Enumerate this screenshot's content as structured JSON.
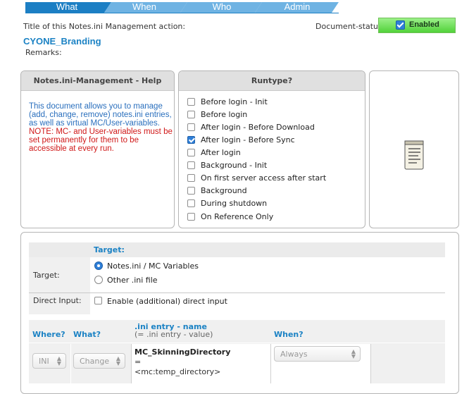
{
  "tabs": [
    {
      "label": "What",
      "active": true
    },
    {
      "label": "When",
      "active": false
    },
    {
      "label": "Who",
      "active": false
    },
    {
      "label": "Admin",
      "active": false
    }
  ],
  "header": {
    "title_label": "Title of this Notes.ini Management action:",
    "doc_name": "CYONE_Branding",
    "remarks_label": "Remarks:",
    "docstatus_label": "Document-status:",
    "status_value": "Enabled",
    "status_checked": true
  },
  "help": {
    "title": "Notes.ini-Management - Help",
    "blue_text": "This document allows you to manage (add, change, remove) notes.ini entries, as well as virtual MC/User-variables.",
    "red_text": "NOTE: MC- and User-variables must be set permanently for them to be accessible at every run."
  },
  "runtype": {
    "title": "Runtype?",
    "options": [
      {
        "label": "Before login - Init",
        "checked": false
      },
      {
        "label": "Before login",
        "checked": false
      },
      {
        "label": "After login - Before Download",
        "checked": false
      },
      {
        "label": "After login - Before Sync",
        "checked": true
      },
      {
        "label": "After login",
        "checked": false
      },
      {
        "label": "Background - Init",
        "checked": false
      },
      {
        "label": "On first server access after start",
        "checked": false
      },
      {
        "label": "Background",
        "checked": false
      },
      {
        "label": "During shutdown",
        "checked": false
      },
      {
        "label": "On Reference Only",
        "checked": false
      }
    ]
  },
  "icons": {
    "notepad": "notepad-icon",
    "status_check": "checkmark-icon"
  },
  "config": {
    "target_heading": "Target:",
    "target_label": "Target:",
    "target_options": [
      {
        "label": "Notes.ini / MC Variables",
        "selected": true
      },
      {
        "label": "Other .ini file",
        "selected": false
      }
    ],
    "direct_input_label": "Direct Input:",
    "direct_input_option": "Enable (additional) direct input",
    "columns": {
      "where": "Where?",
      "what": "What?",
      "entry": ".ini entry - name",
      "entry_sub": "(= .ini entry - value)",
      "when": "When?"
    },
    "row": {
      "where": "INI",
      "what": "Change",
      "entry_name": "MC_SkinningDirectory",
      "equals": "=",
      "entry_value": "<mc:temp_directory>",
      "when": "Always"
    }
  },
  "colors": {
    "tab_active": "#1c7fc4",
    "tab_inactive": "#6fb3e3",
    "accent_blue": "#1b82c4",
    "status_green": "#52d23a",
    "note_red": "#d01818"
  }
}
